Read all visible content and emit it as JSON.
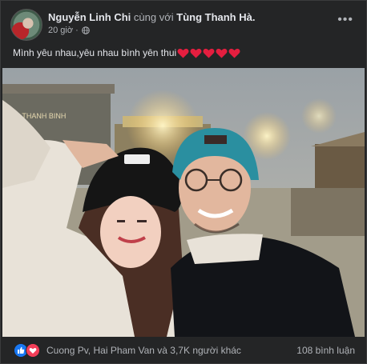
{
  "post": {
    "author": "Nguyễn Linh Chi",
    "with_text": "cùng với",
    "tagged": "Tùng Thanh Hà.",
    "time": "20 giờ ·",
    "privacy_icon": "globe-icon",
    "more_label": "•••",
    "caption": "Mình yêu nhau,yêu nhau bình yên thui",
    "caption_hearts": 5,
    "photo_sign": "HOA THANH BINH"
  },
  "footer": {
    "reactions": [
      "like-icon",
      "love-icon"
    ],
    "reaction_names": "Cuong Pv, Hai Pham Van và 3,7K người khác",
    "comments": "108 bình luận"
  },
  "colors": {
    "background": "#242526",
    "text": "#e4e6eb",
    "secondary": "#b0b3b8",
    "like": "#1877f2",
    "love": "#f33e58",
    "heart": "#e41e3f"
  }
}
